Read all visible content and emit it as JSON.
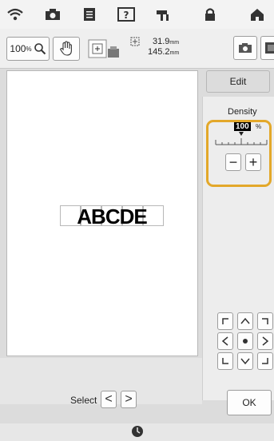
{
  "status_bar": {
    "icons": [
      "wifi-icon",
      "camera-icon",
      "document-icon",
      "help-icon",
      "machine-icon",
      "lock-icon",
      "home-icon"
    ]
  },
  "toolbar": {
    "zoom_value": "100",
    "zoom_unit": "%",
    "size_width": "31.9",
    "size_height": "145.2",
    "size_unit": "mm"
  },
  "canvas": {
    "pattern_text": "ABCDE"
  },
  "select": {
    "label": "Select",
    "prev_symbol": "<",
    "next_symbol": ">"
  },
  "edit_panel": {
    "edit_label": "Edit",
    "density_title": "Density",
    "density_value": "100",
    "density_unit": "%",
    "minus_label": "−",
    "plus_label": "+",
    "ok_label": "OK"
  },
  "colors": {
    "highlight": "#e3a82a",
    "panel": "#ededed",
    "background": "#dcdcdc"
  }
}
